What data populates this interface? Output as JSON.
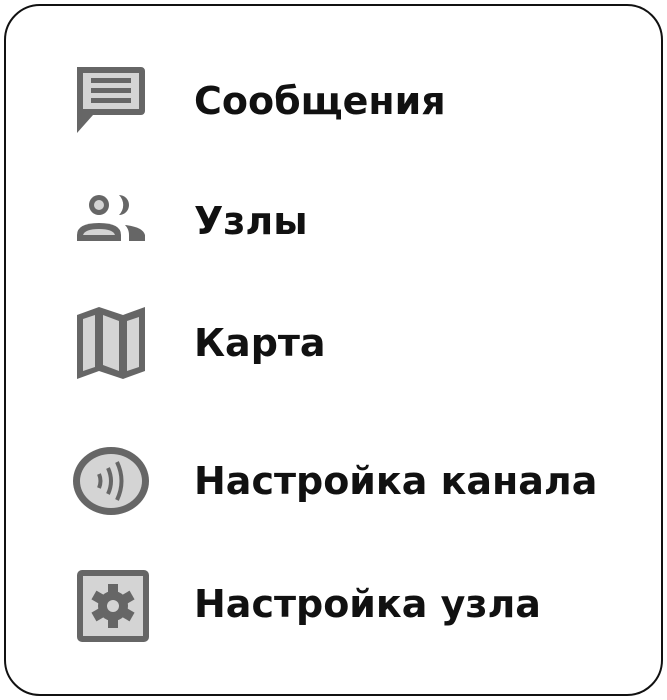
{
  "menu": {
    "items": [
      {
        "label": "Сообщения",
        "icon": "message-icon"
      },
      {
        "label": "Узлы",
        "icon": "people-icon"
      },
      {
        "label": "Карта",
        "icon": "map-icon"
      },
      {
        "label": "Настройка канала",
        "icon": "channel-icon"
      },
      {
        "label": "Настройка узла",
        "icon": "settings-icon"
      }
    ]
  },
  "colors": {
    "icon_stroke": "#666666",
    "icon_fill": "#d4d4d4",
    "text": "#111111"
  }
}
